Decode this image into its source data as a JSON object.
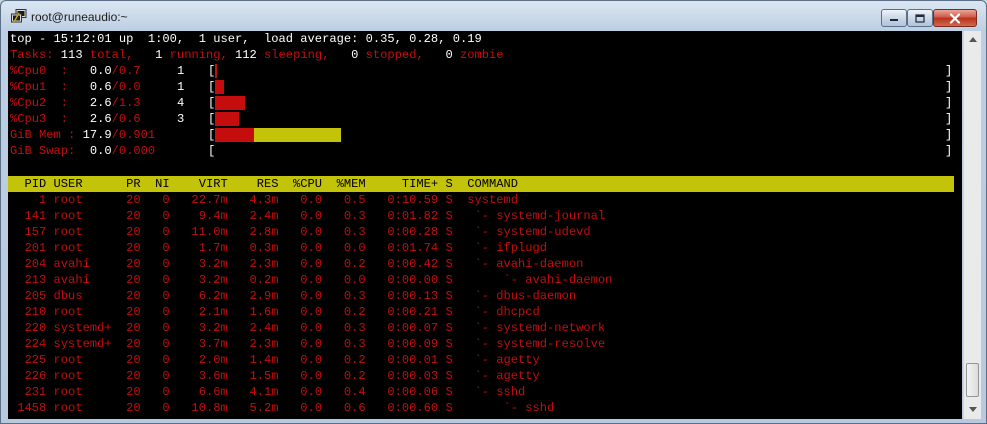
{
  "window": {
    "title": "root@runeaudio:~",
    "icon": "putty-terminal-icon",
    "controls": [
      "minimize-icon",
      "maximize-icon",
      "close-icon"
    ]
  },
  "top": {
    "line1": "top - 15:12:01 up  1:00,  1 user,  load average: 0.35, 0.28, 0.19",
    "tasks": {
      "label": "Tasks:",
      "total": " 113",
      "total_label": " total,",
      "running": "   1",
      "running_label": " running,",
      "sleeping": " 112",
      "sleeping_label": " sleeping,",
      "stopped": "   0",
      "stopped_label": " stopped,",
      "zombie": "   0",
      "zombie_label": " zombie"
    },
    "cpus": [
      {
        "label": "%Cpu0  :",
        "us": "0.0",
        "sy": "0.7",
        "num": "1",
        "fill": 0.0
      },
      {
        "label": "%Cpu1  :",
        "us": "0.6",
        "sy": "0.0",
        "num": "1",
        "fill": 0.012
      },
      {
        "label": "%Cpu2  :",
        "us": "2.6",
        "sy": "1.3",
        "num": "4",
        "fill": 0.04
      },
      {
        "label": "%Cpu3  :",
        "us": "2.6",
        "sy": "0.6",
        "num": "3",
        "fill": 0.032
      }
    ],
    "mem": {
      "label": "GiB Mem :",
      "used": "17.9",
      "total": "0.901",
      "used_fill": 0.053,
      "cache_fill": 0.117
    },
    "swap": {
      "label": "GiB Swap:",
      "used": "0.0",
      "total": "0.000",
      "fill": 0.0
    },
    "header": "  PID USER      PR  NI    VIRT    RES  %CPU  %MEM     TIME+ S  COMMAND",
    "processes": [
      {
        "pid": "1",
        "user": "root",
        "pr": "20",
        "ni": "0",
        "virt": "22.7m",
        "res": "4.3m",
        "cpu": "0.0",
        "mem": "0.5",
        "time": "0:10.59",
        "s": "S",
        "cmd": "systemd"
      },
      {
        "pid": "141",
        "user": "root",
        "pr": "20",
        "ni": "0",
        "virt": "9.4m",
        "res": "2.4m",
        "cpu": "0.0",
        "mem": "0.3",
        "time": "0:01.82",
        "s": "S",
        "cmd": " `- systemd-journal"
      },
      {
        "pid": "157",
        "user": "root",
        "pr": "20",
        "ni": "0",
        "virt": "11.0m",
        "res": "2.8m",
        "cpu": "0.0",
        "mem": "0.3",
        "time": "0:00.28",
        "s": "S",
        "cmd": " `- systemd-udevd"
      },
      {
        "pid": "201",
        "user": "root",
        "pr": "20",
        "ni": "0",
        "virt": "1.7m",
        "res": "0.3m",
        "cpu": "0.0",
        "mem": "0.0",
        "time": "0:01.74",
        "s": "S",
        "cmd": " `- ifplugd"
      },
      {
        "pid": "204",
        "user": "avahi",
        "pr": "20",
        "ni": "0",
        "virt": "3.2m",
        "res": "2.3m",
        "cpu": "0.0",
        "mem": "0.2",
        "time": "0:00.42",
        "s": "S",
        "cmd": " `- avahi-daemon"
      },
      {
        "pid": "213",
        "user": "avahi",
        "pr": "20",
        "ni": "0",
        "virt": "3.2m",
        "res": "0.2m",
        "cpu": "0.0",
        "mem": "0.0",
        "time": "0:00.00",
        "s": "S",
        "cmd": "     `- avahi-daemon"
      },
      {
        "pid": "205",
        "user": "dbus",
        "pr": "20",
        "ni": "0",
        "virt": "6.2m",
        "res": "2.9m",
        "cpu": "0.0",
        "mem": "0.3",
        "time": "0:00.13",
        "s": "S",
        "cmd": " `- dbus-daemon"
      },
      {
        "pid": "210",
        "user": "root",
        "pr": "20",
        "ni": "0",
        "virt": "2.1m",
        "res": "1.6m",
        "cpu": "0.0",
        "mem": "0.2",
        "time": "0:00.21",
        "s": "S",
        "cmd": " `- dhcpcd"
      },
      {
        "pid": "220",
        "user": "systemd+",
        "pr": "20",
        "ni": "0",
        "virt": "3.2m",
        "res": "2.4m",
        "cpu": "0.0",
        "mem": "0.3",
        "time": "0:00.07",
        "s": "S",
        "cmd": " `- systemd-network"
      },
      {
        "pid": "224",
        "user": "systemd+",
        "pr": "20",
        "ni": "0",
        "virt": "3.7m",
        "res": "2.3m",
        "cpu": "0.0",
        "mem": "0.3",
        "time": "0:00.09",
        "s": "S",
        "cmd": " `- systemd-resolve"
      },
      {
        "pid": "225",
        "user": "root",
        "pr": "20",
        "ni": "0",
        "virt": "2.0m",
        "res": "1.4m",
        "cpu": "0.0",
        "mem": "0.2",
        "time": "0:00.01",
        "s": "S",
        "cmd": " `- agetty"
      },
      {
        "pid": "226",
        "user": "root",
        "pr": "20",
        "ni": "0",
        "virt": "3.6m",
        "res": "1.5m",
        "cpu": "0.0",
        "mem": "0.2",
        "time": "0:00.03",
        "s": "S",
        "cmd": " `- agetty"
      },
      {
        "pid": "231",
        "user": "root",
        "pr": "20",
        "ni": "0",
        "virt": "6.6m",
        "res": "4.1m",
        "cpu": "0.0",
        "mem": "0.4",
        "time": "0:00.06",
        "s": "S",
        "cmd": " `- sshd"
      },
      {
        "pid": "1458",
        "user": "root",
        "pr": "20",
        "ni": "0",
        "virt": "10.8m",
        "res": "5.2m",
        "cpu": "0.0",
        "mem": "0.6",
        "time": "0:00.60",
        "s": "S",
        "cmd": "     `- sshd"
      }
    ]
  },
  "colors": {
    "red": "#c50d0d",
    "yellow": "#c3c30a",
    "white": "#ffffff",
    "background": "#000000"
  }
}
